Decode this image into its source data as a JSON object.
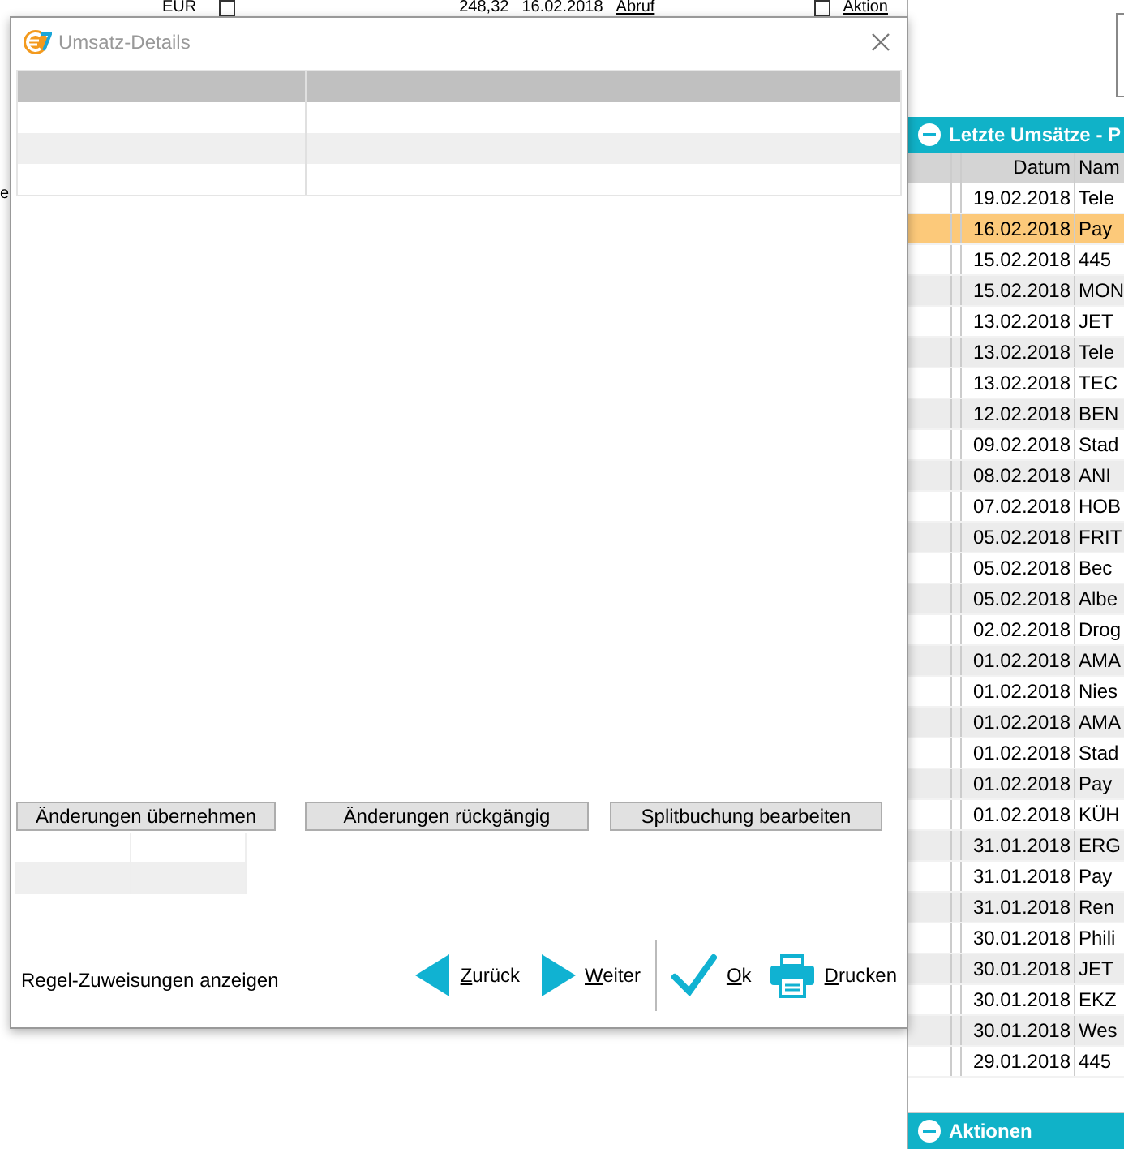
{
  "background_row": {
    "currency": "EUR",
    "amount": "248,32",
    "date": "16.02.2018",
    "link": "Abruf",
    "checkbox_checked": false,
    "action_checkbox_checked": false,
    "action_link": "Aktion"
  },
  "background_text": "e",
  "dialog": {
    "title": "Umsatz-Details",
    "buttons": [
      "Änderungen übernehmen",
      "Änderungen rückgängig",
      "Splitbuchung bearbeiten"
    ],
    "rule_link": "Regel-Zuweisungen anzeigen",
    "nav": [
      {
        "kind": "back",
        "label": "Zurück"
      },
      {
        "kind": "forward",
        "label": "Weiter"
      },
      {
        "kind": "ok",
        "label": "Ok"
      },
      {
        "kind": "print",
        "label": "Drucken"
      }
    ]
  },
  "recent_panel": {
    "title": "Letzte Umsätze - P",
    "columns": [
      "Datum",
      "Nam"
    ],
    "rows": [
      {
        "date": "19.02.2018",
        "name": "Tele",
        "selected": false
      },
      {
        "date": "16.02.2018",
        "name": "Pay",
        "selected": true
      },
      {
        "date": "15.02.2018",
        "name": "445",
        "selected": false
      },
      {
        "date": "15.02.2018",
        "name": "MON",
        "selected": false
      },
      {
        "date": "13.02.2018",
        "name": "JET",
        "selected": false
      },
      {
        "date": "13.02.2018",
        "name": "Tele",
        "selected": false
      },
      {
        "date": "13.02.2018",
        "name": "TEC",
        "selected": false
      },
      {
        "date": "12.02.2018",
        "name": "BEN",
        "selected": false
      },
      {
        "date": "09.02.2018",
        "name": "Stad",
        "selected": false
      },
      {
        "date": "08.02.2018",
        "name": "ANI",
        "selected": false
      },
      {
        "date": "07.02.2018",
        "name": "HOB",
        "selected": false
      },
      {
        "date": "05.02.2018",
        "name": "FRIT",
        "selected": false
      },
      {
        "date": "05.02.2018",
        "name": "Bec",
        "selected": false
      },
      {
        "date": "05.02.2018",
        "name": "Albe",
        "selected": false
      },
      {
        "date": "02.02.2018",
        "name": "Drog",
        "selected": false
      },
      {
        "date": "01.02.2018",
        "name": "AMA",
        "selected": false
      },
      {
        "date": "01.02.2018",
        "name": "Nies",
        "selected": false
      },
      {
        "date": "01.02.2018",
        "name": "AMA",
        "selected": false
      },
      {
        "date": "01.02.2018",
        "name": "Stad",
        "selected": false
      },
      {
        "date": "01.02.2018",
        "name": "Pay",
        "selected": false
      },
      {
        "date": "01.02.2018",
        "name": "KÜH",
        "selected": false
      },
      {
        "date": "31.01.2018",
        "name": "ERG",
        "selected": false
      },
      {
        "date": "31.01.2018",
        "name": "Pay",
        "selected": false
      },
      {
        "date": "31.01.2018",
        "name": "Ren",
        "selected": false
      },
      {
        "date": "30.01.2018",
        "name": "Phili",
        "selected": false
      },
      {
        "date": "30.01.2018",
        "name": "JET",
        "selected": false
      },
      {
        "date": "30.01.2018",
        "name": "EKZ",
        "selected": false
      },
      {
        "date": "30.01.2018",
        "name": "Wes",
        "selected": false
      },
      {
        "date": "29.01.2018",
        "name": "445",
        "selected": false
      }
    ]
  },
  "actions_panel": {
    "title": "Aktionen"
  }
}
